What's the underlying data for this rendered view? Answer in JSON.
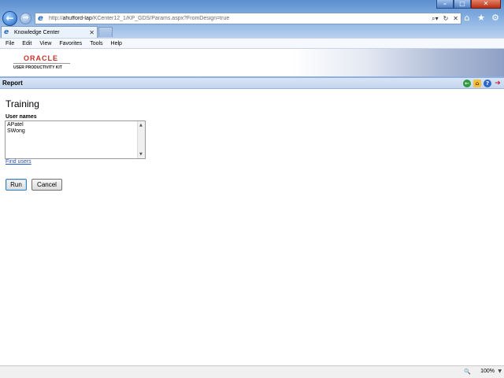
{
  "browser": {
    "address_url_prefix": "http://",
    "address_url_host": "ahufford-lap",
    "address_url_path": "/KCenter12_1/KP_GDS/Params.aspx?FromDesign=true",
    "tab_title": "Knowledge Center",
    "menu": [
      "File",
      "Edit",
      "View",
      "Favorites",
      "Tools",
      "Help"
    ],
    "zoom": "100%"
  },
  "header": {
    "logo_oracle": "ORACLE",
    "logo_upk": "USER PRODUCTIVITY KIT"
  },
  "report_bar": {
    "title": "Report"
  },
  "form": {
    "page_title": "Training",
    "users_label": "User names",
    "users_value": "APatel\nSWong",
    "find_users_link": "Find users",
    "run_label": "Run",
    "cancel_label": "Cancel"
  },
  "icons": {
    "back": "back-arrow-icon",
    "forward": "forward-arrow-icon",
    "search": "search-icon",
    "refresh": "refresh-icon",
    "stop": "stop-icon",
    "home": "home-icon",
    "favorites": "star-icon",
    "tools": "gear-icon",
    "report_back": "green-back-icon",
    "report_home": "home-icon",
    "report_help": "help-icon",
    "report_exit": "exit-icon"
  },
  "colors": {
    "report_bar": "#c3d5ee",
    "oracle_red": "#c6302b",
    "link": "#1f4fc0"
  }
}
